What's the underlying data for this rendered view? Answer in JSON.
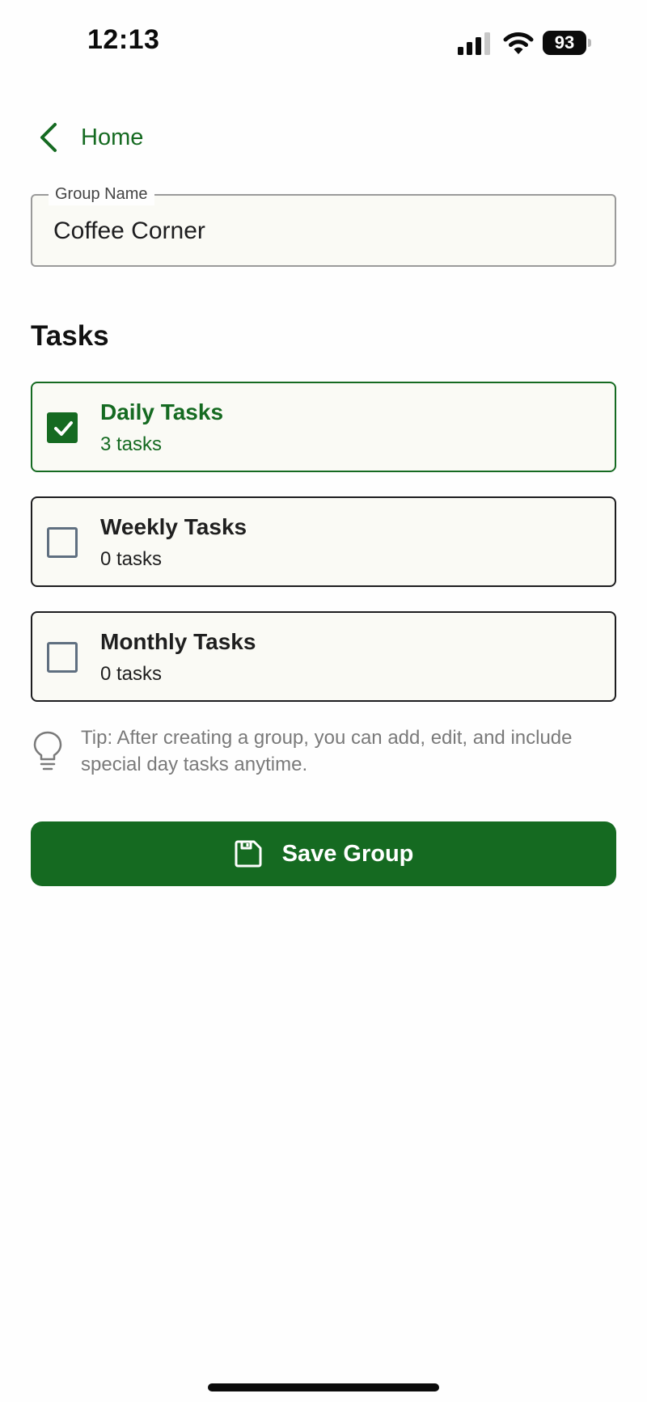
{
  "status_bar": {
    "time": "12:13",
    "battery_level": "93"
  },
  "nav": {
    "back_label": "Home"
  },
  "group_name": {
    "label": "Group Name",
    "value": "Coffee Corner"
  },
  "tasks_section": {
    "heading": "Tasks",
    "items": [
      {
        "title": "Daily Tasks",
        "count": "3 tasks",
        "checked": true
      },
      {
        "title": "Weekly Tasks",
        "count": "0 tasks",
        "checked": false
      },
      {
        "title": "Monthly Tasks",
        "count": "0 tasks",
        "checked": false
      }
    ]
  },
  "tip": {
    "text": "Tip: After creating a group, you can add, edit, and include special day tasks anytime.",
    "icon": "lightbulb-icon"
  },
  "save_button": {
    "label": "Save Group",
    "icon": "save-icon"
  },
  "colors": {
    "accent": "#156a21",
    "card_background": "#fafaf5",
    "tip_text": "#7a7a7a"
  }
}
